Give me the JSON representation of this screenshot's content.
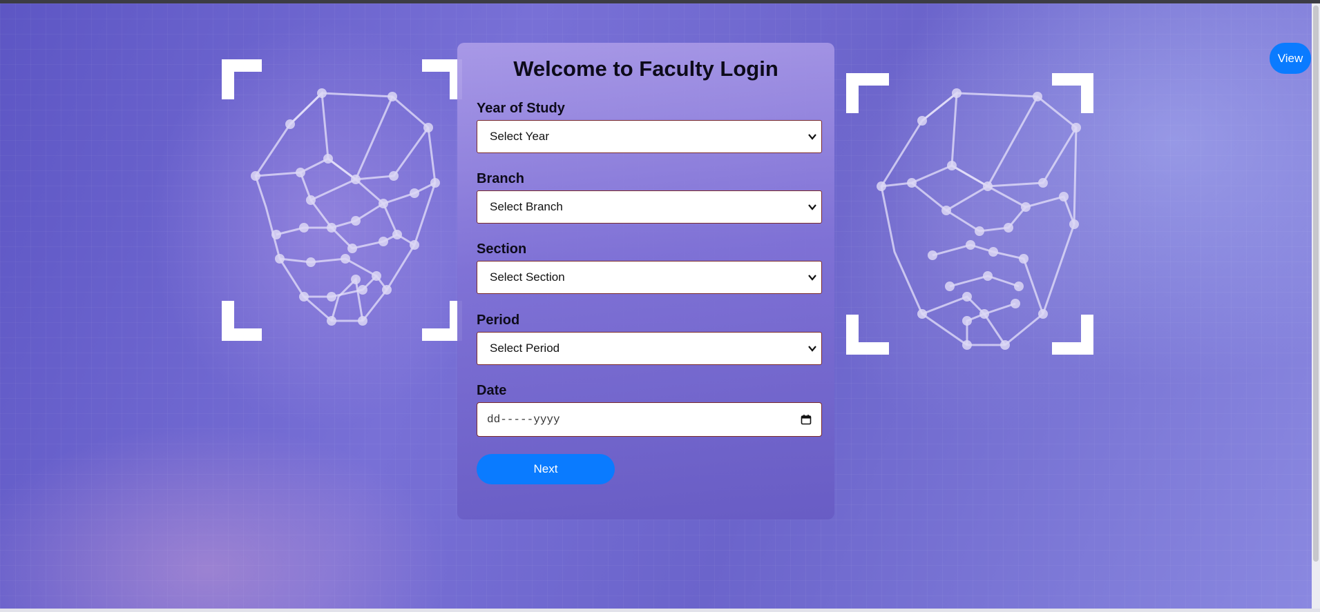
{
  "form": {
    "title": "Welcome to Faculty Login",
    "year": {
      "label": "Year of Study",
      "selected": "Select Year"
    },
    "branch": {
      "label": "Branch",
      "selected": "Select Branch"
    },
    "section": {
      "label": "Section",
      "selected": "Select Section"
    },
    "period": {
      "label": "Period",
      "selected": "Select Period"
    },
    "date": {
      "label": "Date",
      "placeholder": "dd-----yyyy"
    },
    "next_label": "Next"
  },
  "view_label": "View",
  "icons": {
    "select_chevron": "chevron-down-icon",
    "date_picker": "calendar-icon"
  },
  "colors": {
    "accent": "#0a7bff",
    "card_top": "#ac9ce8",
    "card_bottom": "#685cc4",
    "field_border": "#7a2a2a",
    "page_background": "#6a62c8"
  }
}
